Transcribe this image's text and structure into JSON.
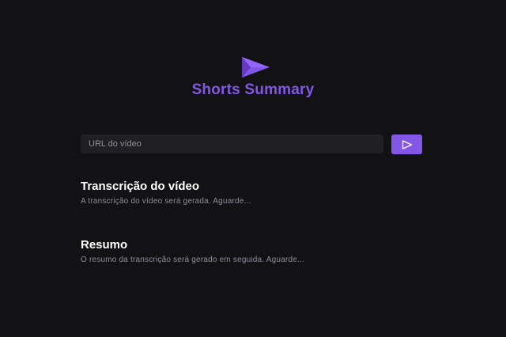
{
  "app": {
    "title": "Shorts Summary",
    "logo_icon": "play-triangle-icon",
    "accent_color": "#8257e5",
    "background_color": "#121214"
  },
  "search": {
    "placeholder": "URL do vídeo",
    "value": "",
    "submit_icon": "send-play-icon"
  },
  "transcription": {
    "title": "Transcrição do vídeo",
    "text": "A transcrição do vídeo será gerada. Aguarde..."
  },
  "summary": {
    "title": "Resumo",
    "text": "O resumo da transcrição será gerado em seguida. Aguarde..."
  }
}
